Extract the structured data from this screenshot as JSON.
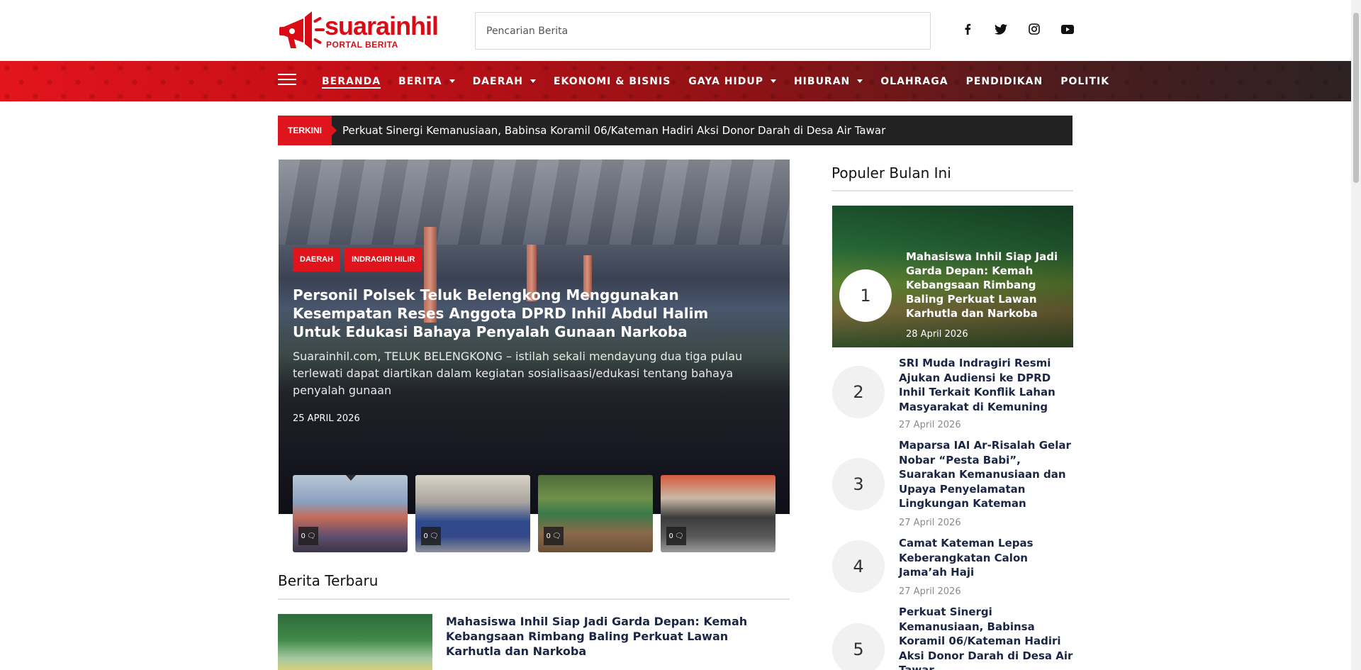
{
  "brand": {
    "name": "suarainhil",
    "tagline": "PORTAL BERITA",
    "color": "#d90c16"
  },
  "search": {
    "placeholder": "Pencarian Berita"
  },
  "social": [
    "facebook-icon",
    "twitter-icon",
    "instagram-icon",
    "youtube-icon"
  ],
  "nav": {
    "items": [
      {
        "label": "BERANDA",
        "dropdown": false,
        "active": true
      },
      {
        "label": "BERITA",
        "dropdown": true
      },
      {
        "label": "DAERAH",
        "dropdown": true
      },
      {
        "label": "EKONOMI & BISNIS",
        "dropdown": false
      },
      {
        "label": "GAYA HIDUP",
        "dropdown": true
      },
      {
        "label": "HIBURAN",
        "dropdown": true
      },
      {
        "label": "OLAHRAGA",
        "dropdown": false
      },
      {
        "label": "PENDIDIKAN",
        "dropdown": false
      },
      {
        "label": "POLITIK",
        "dropdown": false
      }
    ]
  },
  "ticker": {
    "label": "TERKINI",
    "text": "Perkuat Sinergi Kemanusiaan, Babinsa Koramil 06/Kateman Hadiri Aksi Donor Darah di Desa Air Tawar"
  },
  "hero": {
    "tags": [
      "DAERAH",
      "INDRAGIRI HILIR"
    ],
    "title": "Personil Polsek Teluk Belengkong Menggunakan Kesempatan Reses Anggota DPRD Inhil Abdul Halim Untuk Edukasi Bahaya Penyalah Gunaan Narkoba",
    "excerpt": "Suarainhil.com, TELUK BELENGKONG – istilah sekali mendayung dua tiga pulau terlewati dapat diartikan dalam kegiatan sosialisaasi/edukasi tentang bahaya penyalah gunaan",
    "date": "25 APRIL 2026"
  },
  "thumbs": [
    {
      "count": "0"
    },
    {
      "count": "0"
    },
    {
      "count": "0"
    },
    {
      "count": "0"
    }
  ],
  "latest": {
    "title": "Berita Terbaru",
    "items": [
      {
        "title": "Mahasiswa Inhil Siap Jadi Garda Depan: Kemah Kebangsaan Rimbang Baling Perkuat Lawan Karhutla dan Narkoba"
      }
    ]
  },
  "popular": {
    "title": "Populer Bulan Ini",
    "featured": {
      "rank": "1",
      "title": "Mahasiswa Inhil Siap Jadi Garda Depan: Kemah Kebangsaan Rimbang Baling Perkuat Lawan Karhutla dan Narkoba",
      "date": "28 April 2026"
    },
    "items": [
      {
        "rank": "2",
        "title": "SRI Muda Indragiri Resmi Ajukan Audiensi ke DPRD Inhil Terkait Konflik Lahan Masyarakat di Kemuning",
        "date": "27 April 2026"
      },
      {
        "rank": "3",
        "title": "Maparsa IAI Ar-Risalah Gelar Nobar “Pesta Babi”, Suarakan Kemanusiaan dan Upaya Penyelamatan Lingkungan Kateman",
        "date": "27 April 2026"
      },
      {
        "rank": "4",
        "title": "Camat Kateman Lepas Keberangkatan Calon Jama’ah Haji",
        "date": "27 April 2026"
      },
      {
        "rank": "5",
        "title": "Perkuat Sinergi Kemanusiaan, Babinsa Koramil 06/Kateman Hadiri Aksi Donor Darah di Desa Air Tawar",
        "date": ""
      }
    ]
  }
}
